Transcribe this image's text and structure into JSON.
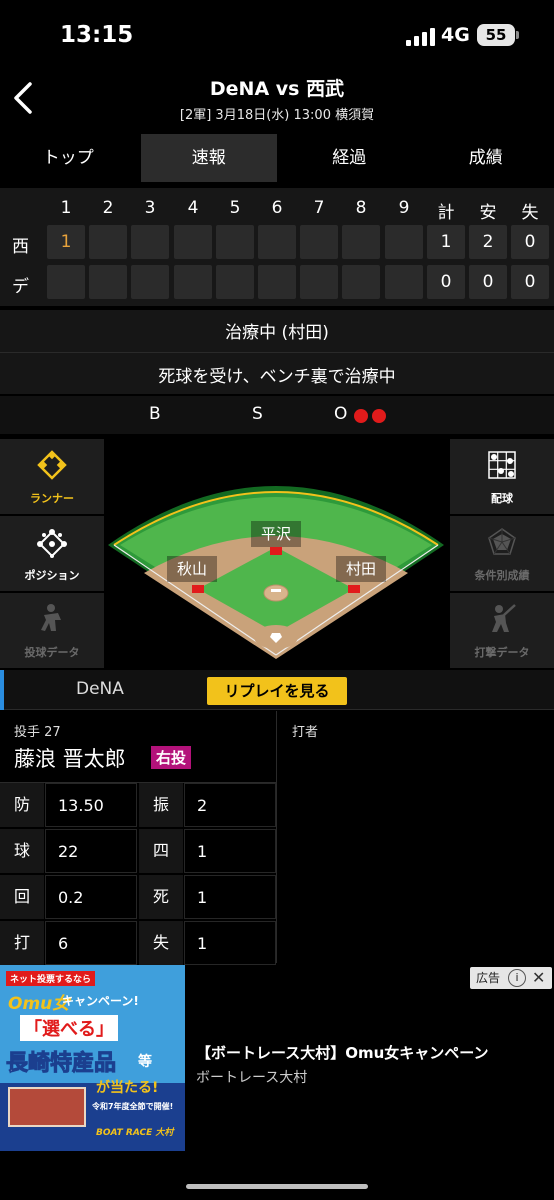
{
  "status_bar": {
    "time": "13:15",
    "network": "4G",
    "battery": "55"
  },
  "header": {
    "title": "DeNA vs 西武",
    "subtitle": "[2軍] 3月18日(水) 13:00 横須賀"
  },
  "tabs": [
    {
      "label": "トップ",
      "active": false
    },
    {
      "label": "速報",
      "active": true
    },
    {
      "label": "経過",
      "active": false
    },
    {
      "label": "成績",
      "active": false
    }
  ],
  "scoreboard": {
    "innings": [
      "1",
      "2",
      "3",
      "4",
      "5",
      "6",
      "7",
      "8",
      "9"
    ],
    "totals_headers": [
      "計",
      "安",
      "失"
    ],
    "rows": [
      {
        "team": "西",
        "innings": [
          "1",
          "",
          "",
          "",
          "",
          "",
          "",
          "",
          ""
        ],
        "totals": [
          "1",
          "2",
          "0"
        ]
      },
      {
        "team": "デ",
        "innings": [
          "",
          "",
          "",
          "",
          "",
          "",
          "",
          "",
          ""
        ],
        "totals": [
          "0",
          "0",
          "0"
        ]
      }
    ]
  },
  "event": {
    "title": "治療中 (村田)",
    "description": "死球を受け、ベンチ裏で治療中"
  },
  "count": {
    "balls_label": "B",
    "strikes_label": "S",
    "outs_label": "O",
    "balls": 0,
    "strikes": 0,
    "outs": 2
  },
  "field": {
    "left_buttons": [
      {
        "label": "ランナー",
        "icon": "diamond-icon",
        "active": true
      },
      {
        "label": "ポジション",
        "icon": "position-icon",
        "active": false
      },
      {
        "label": "投球データ",
        "icon": "pitcher-icon",
        "active": false,
        "disabled": true
      }
    ],
    "right_buttons": [
      {
        "label": "配球",
        "icon": "pitch-grid-icon",
        "active": false
      },
      {
        "label": "条件別成績",
        "icon": "radar-icon",
        "active": false,
        "disabled": true
      },
      {
        "label": "打撃データ",
        "icon": "batter-icon",
        "active": false,
        "disabled": true
      }
    ],
    "runners": {
      "second": "平沢",
      "third": "秋山",
      "first": "村田"
    }
  },
  "team_row": {
    "team": "DeNA",
    "replay_label": "リプレイを見る"
  },
  "pitcher": {
    "position_number": "投手 27",
    "name": "藤浪 晋太郎",
    "hand": "右投",
    "stats": [
      {
        "label": "防",
        "value": "13.50"
      },
      {
        "label": "振",
        "value": "2"
      },
      {
        "label": "球",
        "value": "22"
      },
      {
        "label": "四",
        "value": "1"
      },
      {
        "label": "回",
        "value": "0.2"
      },
      {
        "label": "死",
        "value": "1"
      },
      {
        "label": "打",
        "value": "6"
      },
      {
        "label": "失",
        "value": "1"
      }
    ]
  },
  "batter": {
    "label": "打者"
  },
  "ad": {
    "badge": "広告",
    "title": "【ボートレース大村】Omu女キャンペーン",
    "sponsor": "ボートレース大村",
    "image_texts": {
      "top": "ネット投票するなら",
      "brand": "Omu女",
      "campaign": "キャンペーン!",
      "choose": "「選べる」",
      "product": "長崎特産品",
      "suffix": "等",
      "win": "が当たる!",
      "notice": "令和7年度全節で開催!",
      "footer": "BOAT RACE 大村"
    }
  },
  "colors": {
    "accent_yellow": "#f2c21b",
    "out_red": "#e11b1b",
    "highlight_orange": "#e8a33c",
    "hand_badge": "#b3127a",
    "team_accent": "#2a8de0"
  }
}
